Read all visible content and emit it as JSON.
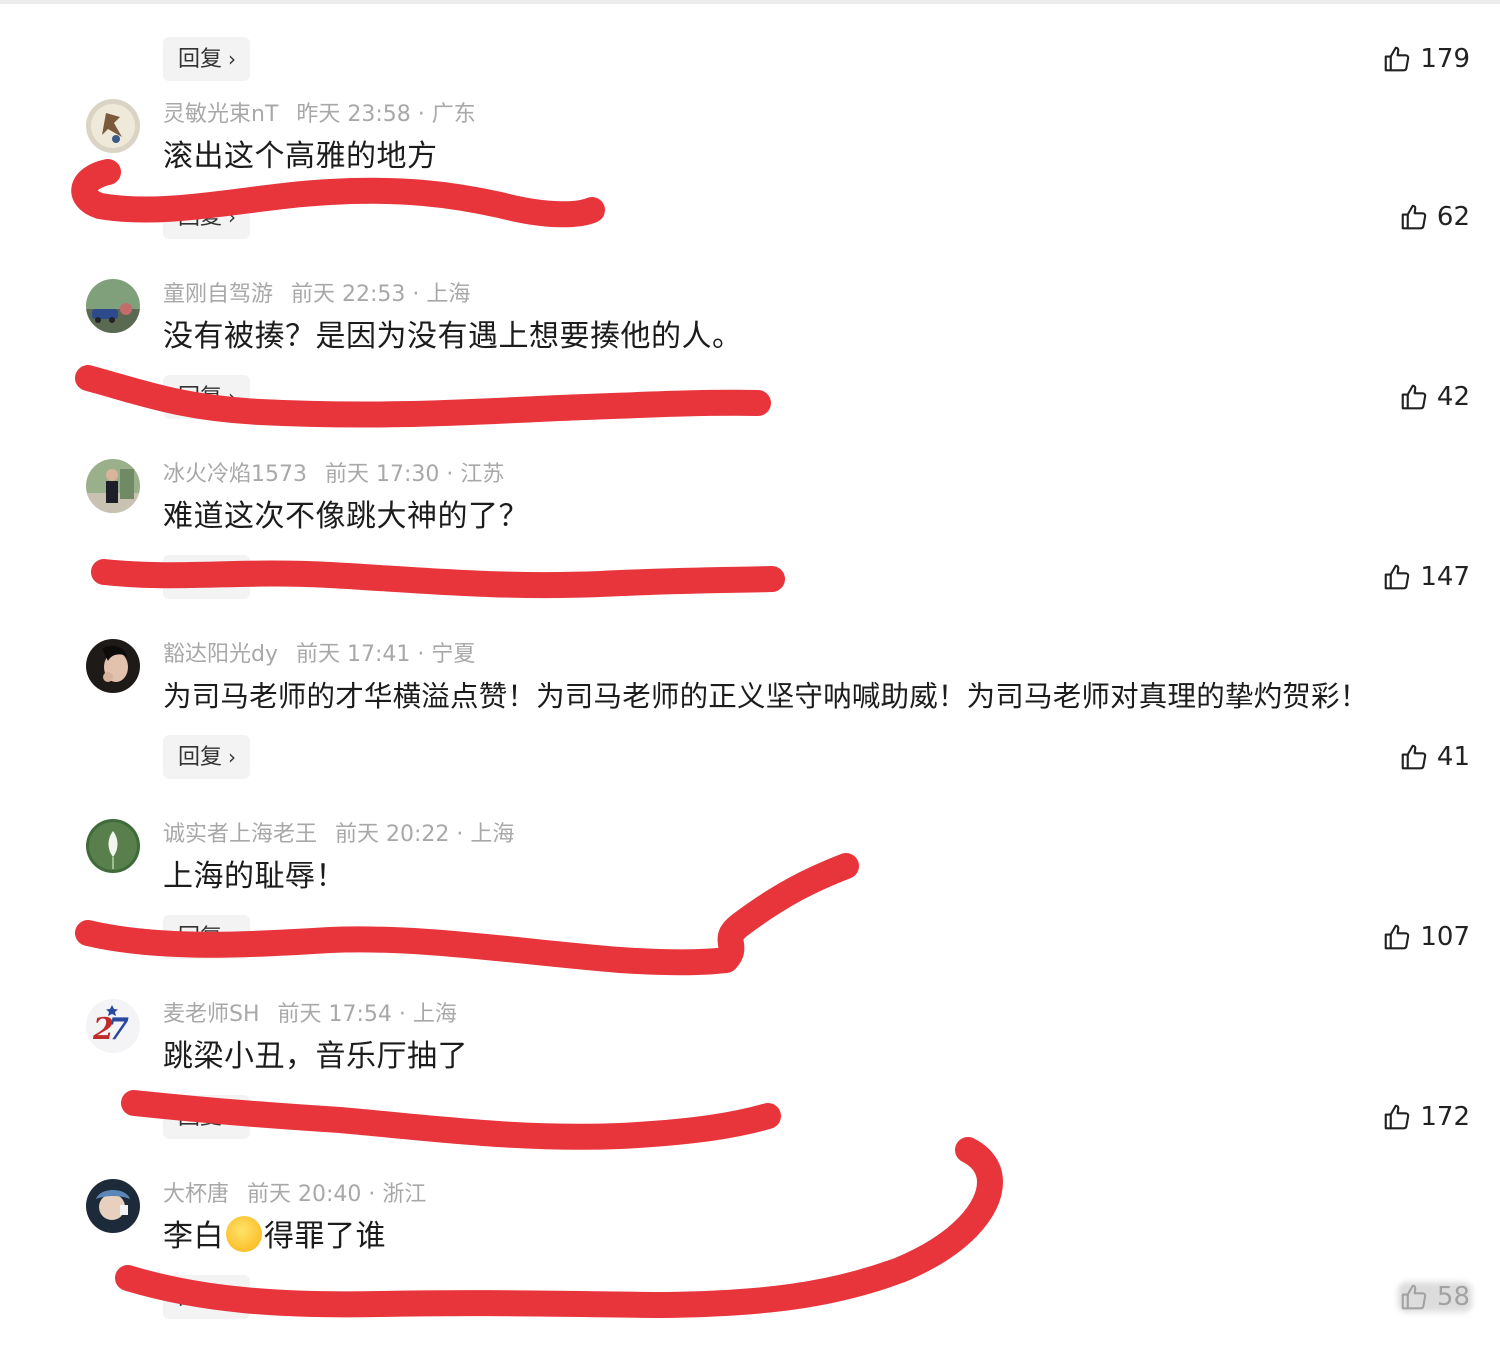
{
  "colors": {
    "scribble": "#e8343b",
    "meta": "#a8a8a8",
    "reply_bg": "#f3f3f3"
  },
  "icons": {
    "like": "thumbs-up-icon",
    "reply_arrow": "chevron-right-icon"
  },
  "top_item": {
    "reply_label": "回复",
    "reply_chevron": "›",
    "likes": "179"
  },
  "comments": [
    {
      "user": "灵敏光束nT",
      "time": "昨天 23:58",
      "region": "广东",
      "text": "滚出这个高雅的地方",
      "reply_label": "回复",
      "reply_chevron": "›",
      "likes": "62"
    },
    {
      "user": "童刚自驾游",
      "time": "前天 22:53",
      "region": "上海",
      "text": "没有被揍？是因为没有遇上想要揍他的人。",
      "reply_label": "回复",
      "reply_chevron": "›",
      "likes": "42"
    },
    {
      "user": "冰火冷焰1573",
      "time": "前天 17:30",
      "region": "江苏",
      "text": "难道这次不像跳大神的了？",
      "reply_label": "回复",
      "reply_chevron": "›",
      "likes": "147"
    },
    {
      "user": "豁达阳光dy",
      "time": "前天 17:41",
      "region": "宁夏",
      "text": "为司马老师的才华横溢点赞！为司马老师的正义坚守呐喊助威！为司马老师对真理的挚灼贺彩！",
      "reply_label": "回复",
      "reply_chevron": "›",
      "likes": "41"
    },
    {
      "user": "诚实者上海老王",
      "time": "前天 20:22",
      "region": "上海",
      "text": "上海的耻辱！",
      "reply_label": "回复",
      "reply_chevron": "›",
      "likes": "107"
    },
    {
      "user": "麦老师SH",
      "time": "前天 17:54",
      "region": "上海",
      "text": "跳梁小丑，音乐厅抽了",
      "reply_label": "回复",
      "reply_chevron": "›",
      "likes": "172"
    },
    {
      "user": "大杯唐",
      "time": "前天 20:40",
      "region": "浙江",
      "text_before": "李白",
      "text_after": "得罪了谁",
      "emoji": "laughing-crying-emoji",
      "reply_label": "回复",
      "reply_chevron": "›",
      "likes": "58"
    }
  ]
}
